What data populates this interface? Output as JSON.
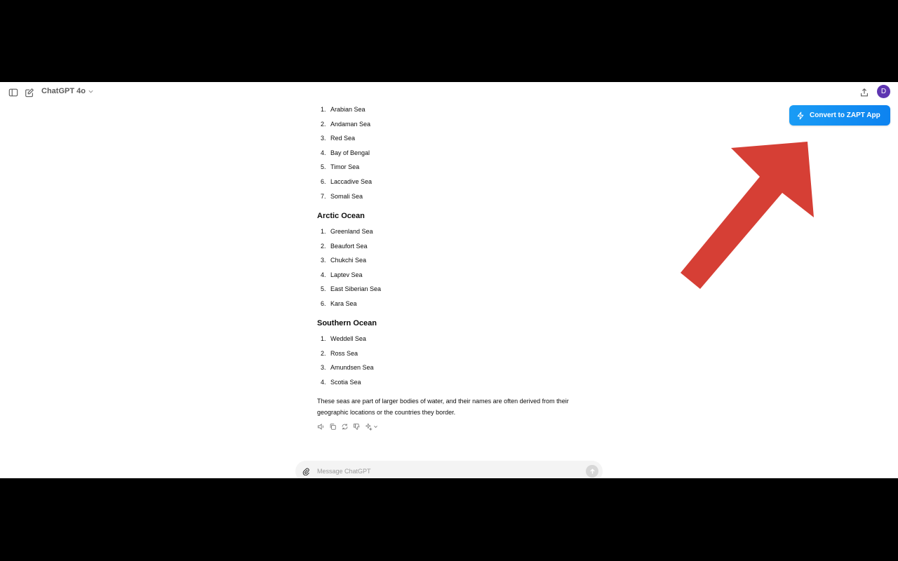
{
  "header": {
    "model_label": "ChatGPT 4o",
    "avatar_initial": "D"
  },
  "extension": {
    "button_label": "Convert to ZAPT App"
  },
  "conversation": {
    "indian_ocean_items": [
      "Arabian Sea",
      "Andaman Sea",
      "Red Sea",
      "Bay of Bengal",
      "Timor Sea",
      "Laccadive Sea",
      "Somali Sea"
    ],
    "arctic_title": "Arctic Ocean",
    "arctic_items": [
      "Greenland Sea",
      "Beaufort Sea",
      "Chukchi Sea",
      "Laptev Sea",
      "East Siberian Sea",
      "Kara Sea"
    ],
    "southern_title": "Southern Ocean",
    "southern_items": [
      "Weddell Sea",
      "Ross Sea",
      "Amundsen Sea",
      "Scotia Sea"
    ],
    "closing_paragraph": "These seas are part of larger bodies of water, and their names are often derived from their geographic locations or the countries they border."
  },
  "composer": {
    "placeholder": "Message ChatGPT"
  },
  "colors": {
    "zapt_button": "#1a9cf5",
    "arrow": "#d63f35",
    "avatar": "#5e35b1"
  }
}
